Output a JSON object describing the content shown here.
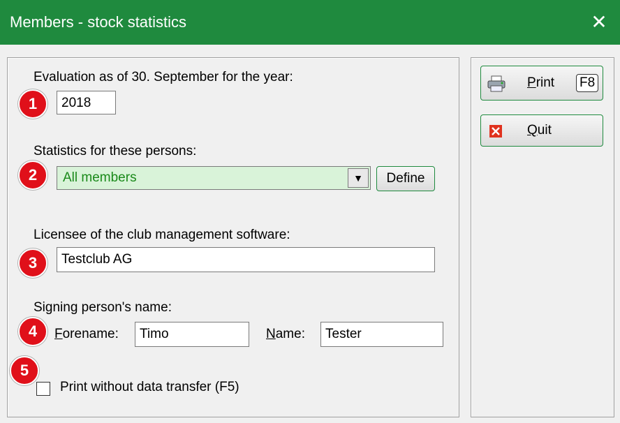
{
  "window": {
    "title": "Members - stock statistics",
    "close_glyph": "✕"
  },
  "evaluation": {
    "label": "Evaluation as of 30. September for the year:",
    "year": "2018"
  },
  "persons": {
    "label": "Statistics for these persons:",
    "selected": "All members",
    "define_button": "Define"
  },
  "licensee": {
    "label": "Licensee of the club management software:",
    "value": "Testclub AG"
  },
  "signing": {
    "label": "Signing person's name:",
    "forename_label_first": "F",
    "forename_label_rest": "orename:",
    "forename_value": "Timo",
    "name_label_first": "N",
    "name_label_rest": "ame:",
    "name_value": "Tester"
  },
  "print_without": {
    "label": "Print without data transfer (F5)",
    "checked": false
  },
  "buttons": {
    "print": {
      "label_first": "P",
      "label_rest": "rint",
      "shortcut": "F8",
      "icon": "printer-icon"
    },
    "quit": {
      "label_first": "Q",
      "label_rest": "uit",
      "icon": "close-red-icon"
    }
  },
  "badges": [
    "1",
    "2",
    "3",
    "4",
    "5"
  ],
  "colors": {
    "title_bar": "#1f8a3e",
    "badge": "#e0101a",
    "combo_bg": "#d9f3d9",
    "combo_text": "#1a8a1a"
  }
}
